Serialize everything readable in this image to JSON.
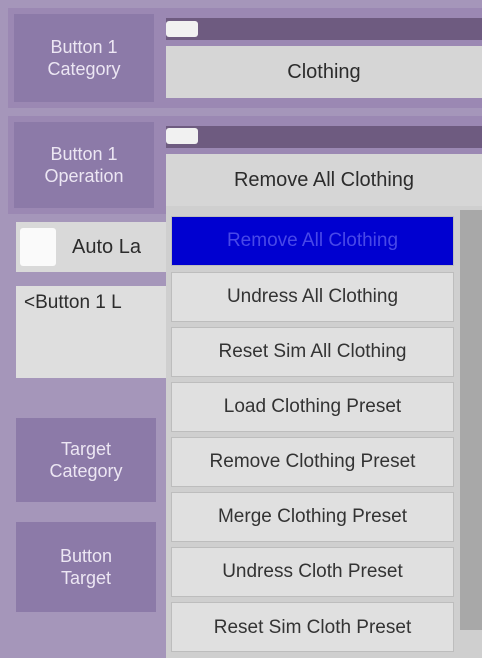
{
  "rows": {
    "category": {
      "label": "Button 1\nCategory",
      "value": "Clothing"
    },
    "operation": {
      "label": "Button 1\nOperation",
      "value": "Remove All Clothing"
    },
    "auto_label": {
      "label": "Auto La"
    },
    "button_label": {
      "value": "<Button 1 L"
    },
    "target_category": {
      "label": "Target\nCategory"
    },
    "button_target": {
      "label": "Button\nTarget"
    }
  },
  "dropdown": {
    "items": [
      "Remove All Clothing",
      "Undress All Clothing",
      "Reset Sim All Clothing",
      "Load Clothing Preset",
      "Remove Clothing Preset",
      "Merge Clothing Preset",
      "Undress Cloth Preset",
      "Reset Sim Cloth Preset"
    ],
    "selected_index": 0
  },
  "colors": {
    "background": "#a596ba",
    "label_bg": "#8c7aa8",
    "selected_item": "#0000d0"
  }
}
